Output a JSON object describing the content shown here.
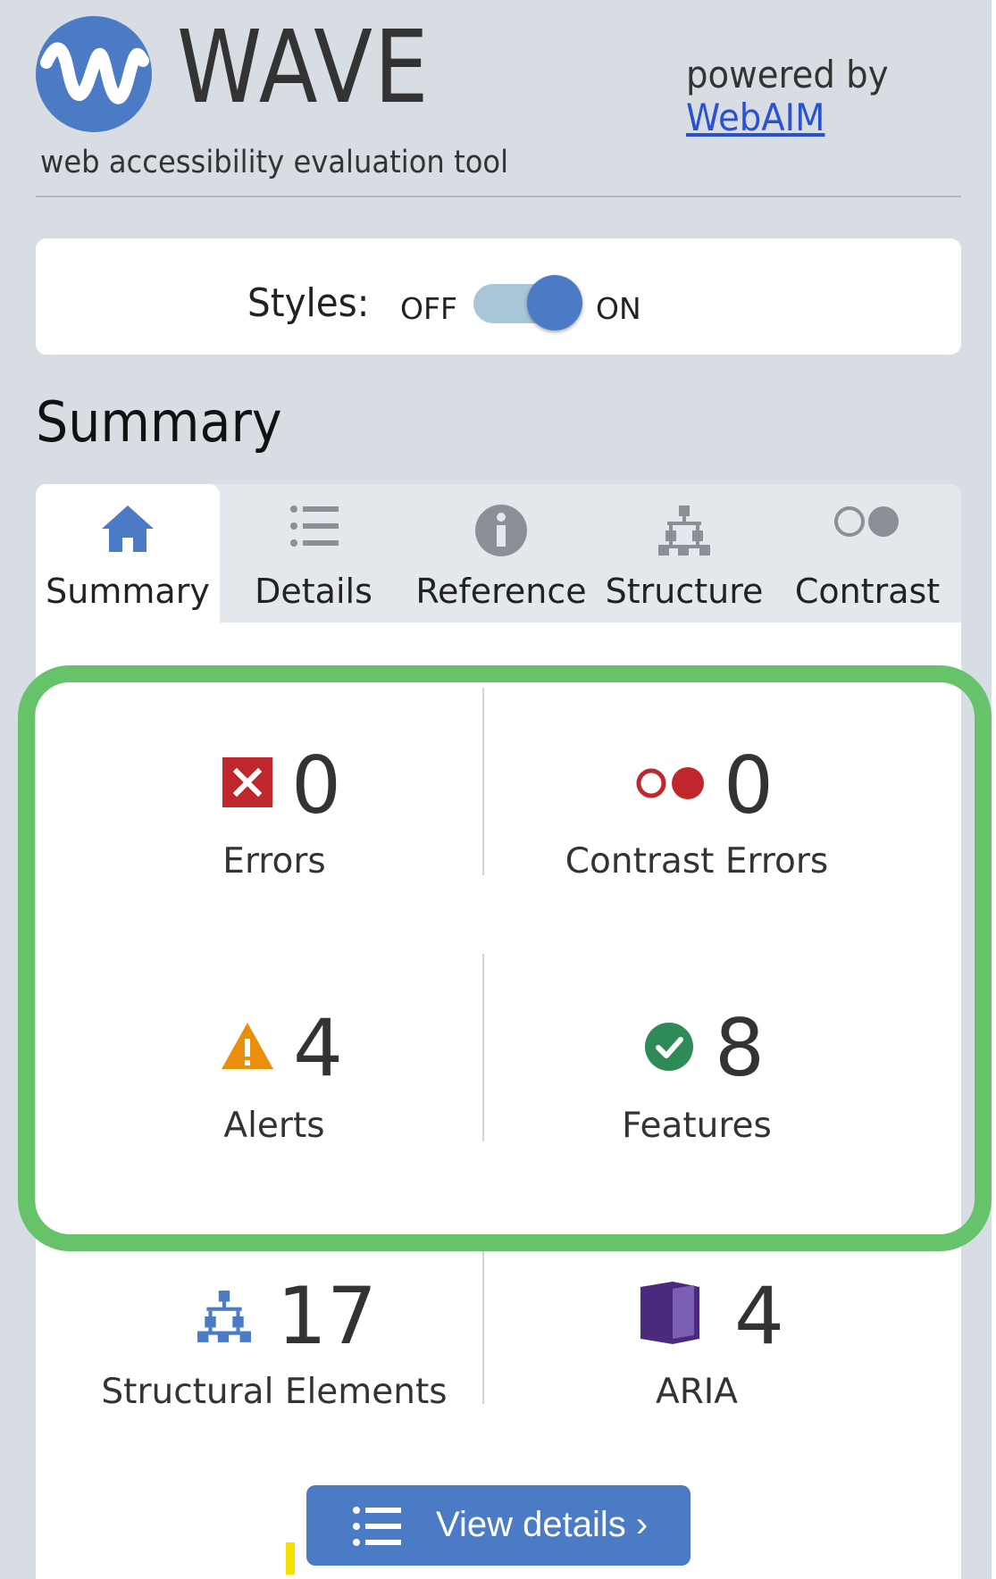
{
  "header": {
    "brand": "WAVE",
    "tagline": "web accessibility evaluation tool",
    "powered_by": "powered by",
    "powered_link": "WebAIM",
    "logo_icon": "wave-logo-icon",
    "link_color": "#2851d6"
  },
  "styles_toggle": {
    "label": "Styles:",
    "off_label": "OFF",
    "on_label": "ON",
    "state": "on"
  },
  "summary_heading": "Summary",
  "tabs": [
    {
      "label": "Summary",
      "icon": "home-icon",
      "active": true
    },
    {
      "label": "Details",
      "icon": "list-icon",
      "active": false
    },
    {
      "label": "Reference",
      "icon": "info-icon",
      "active": false
    },
    {
      "label": "Structure",
      "icon": "structure-tree-icon",
      "active": false
    },
    {
      "label": "Contrast",
      "icon": "contrast-circles-icon",
      "active": false
    }
  ],
  "stats": {
    "errors": {
      "count": "0",
      "label": "Errors",
      "icon": "error-x-icon",
      "color": "#c0272d"
    },
    "contrast_errors": {
      "count": "0",
      "label": "Contrast Errors",
      "icon": "contrast-error-icon",
      "color": "#c0272d"
    },
    "alerts": {
      "count": "4",
      "label": "Alerts",
      "icon": "alert-triangle-icon",
      "color": "#e8900c"
    },
    "features": {
      "count": "8",
      "label": "Features",
      "icon": "feature-check-icon",
      "color": "#2e8b57"
    },
    "structural": {
      "count": "17",
      "label": "Structural Elements",
      "icon": "structure-tree-icon",
      "color": "#4a7bc4"
    },
    "aria": {
      "count": "4",
      "label": "ARIA",
      "icon": "aria-cube-icon",
      "color": "#5a3a8c"
    }
  },
  "view_details": {
    "label": "View details ›",
    "icon": "list-icon"
  },
  "colors": {
    "accent": "#4a7bc4",
    "highlight_border": "#66c36a",
    "panel_bg": "#d7dde3"
  }
}
